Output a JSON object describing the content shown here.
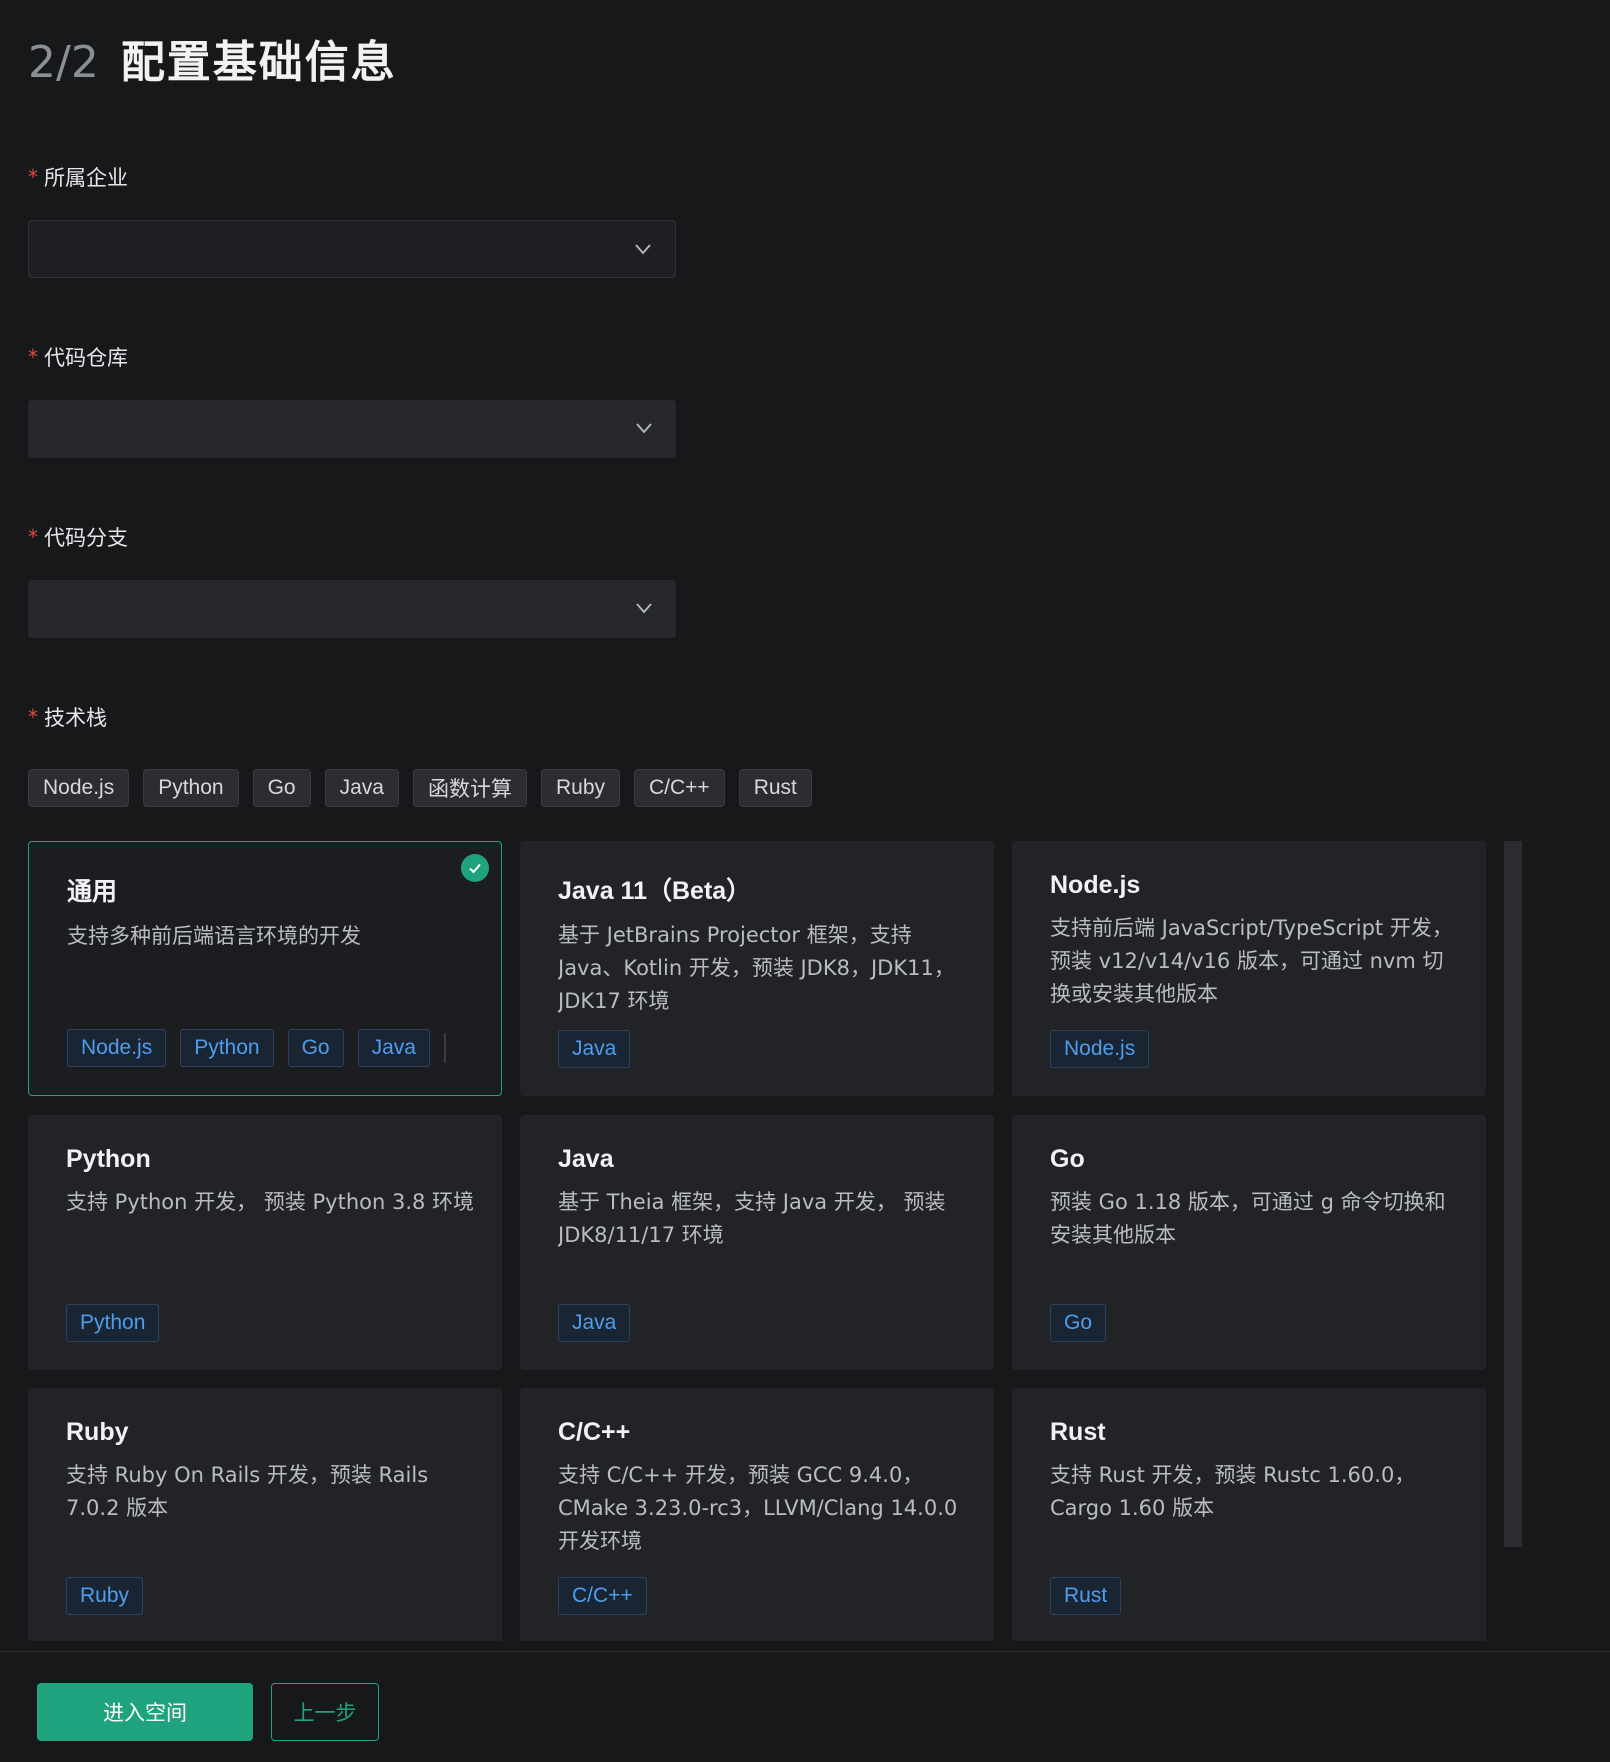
{
  "header": {
    "step": "2/2",
    "title": "配置基础信息"
  },
  "form": {
    "company": {
      "label": "所属企业",
      "required_mark": "*",
      "value": ""
    },
    "repo": {
      "label": "代码仓库",
      "required_mark": "*",
      "value": ""
    },
    "branch": {
      "label": "代码分支",
      "required_mark": "*",
      "value": ""
    },
    "stack": {
      "label": "技术栈",
      "required_mark": "*"
    }
  },
  "filters": [
    "Node.js",
    "Python",
    "Go",
    "Java",
    "函数计算",
    "Ruby",
    "C/C++",
    "Rust"
  ],
  "templates": [
    {
      "title": "通用",
      "desc": "支持多种前后端语言环境的开发",
      "tags": [
        "Node.js",
        "Python",
        "Go",
        "Java"
      ],
      "selected": true
    },
    {
      "title": "Java 11（Beta）",
      "desc": "基于 JetBrains Projector 框架，支持 Java、Kotlin 开发，预装 JDK8，JDK11，JDK17 环境",
      "tags": [
        "Java"
      ],
      "selected": false
    },
    {
      "title": "Node.js",
      "desc": "支持前后端 JavaScript/TypeScript 开发，预装 v12/v14/v16 版本，可通过 nvm 切换或安装其他版本",
      "tags": [
        "Node.js"
      ],
      "selected": false
    },
    {
      "title": "Python",
      "desc": "支持 Python 开发， 预装 Python 3.8 环境",
      "tags": [
        "Python"
      ],
      "selected": false
    },
    {
      "title": "Java",
      "desc": "基于 Theia 框架，支持 Java 开发， 预装 JDK8/11/17 环境",
      "tags": [
        "Java"
      ],
      "selected": false
    },
    {
      "title": "Go",
      "desc": "预装 Go 1.18 版本，可通过 g 命令切换和安装其他版本",
      "tags": [
        "Go"
      ],
      "selected": false
    },
    {
      "title": "Ruby",
      "desc": "支持 Ruby On Rails 开发，预装 Rails 7.0.2 版本",
      "tags": [
        "Ruby"
      ],
      "selected": false
    },
    {
      "title": "C/C++",
      "desc": "支持 C/C++ 开发，预装 GCC 9.4.0，CMake 3.23.0-rc3，LLVM/Clang 14.0.0 开发环境",
      "tags": [
        "C/C++"
      ],
      "selected": false
    },
    {
      "title": "Rust",
      "desc": "支持 Rust 开发，预装 Rustc 1.60.0，Cargo 1.60 版本",
      "tags": [
        "Rust"
      ],
      "selected": false
    }
  ],
  "footer": {
    "primary_label": "进入空间",
    "secondary_label": "上一步"
  },
  "colors": {
    "accent": "#1fa37e",
    "tag_text": "#4e9dee",
    "required": "#e0493e"
  },
  "icons": {
    "select_arrow": "chevron-down-icon",
    "selected_mark": "check-icon"
  }
}
